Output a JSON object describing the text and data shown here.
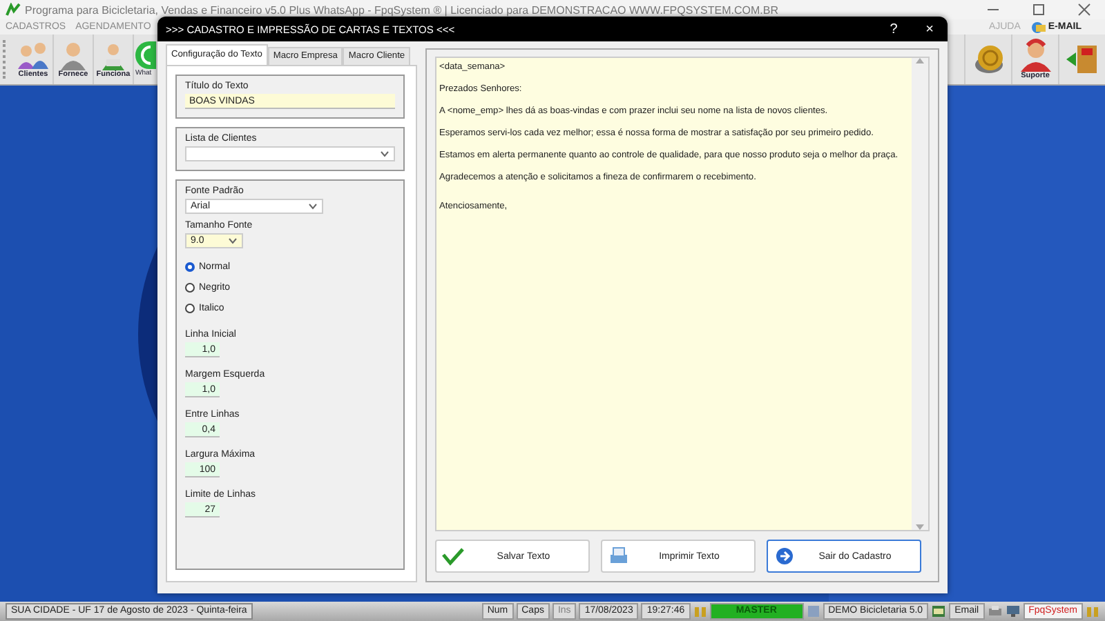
{
  "app": {
    "title": "Programa para Bicicletaria, Vendas e Financeiro v5.0 Plus WhatsApp - FpqSystem ® | Licenciado para  DEMONSTRACAO WWW.FPQSYSTEM.COM.BR",
    "menu": [
      {
        "label": "CADASTROS"
      },
      {
        "label": "AGENDAMENTO"
      }
    ],
    "menu_right": [
      {
        "kind": "text",
        "label": "AJUDA"
      },
      {
        "kind": "email",
        "label": "E-MAIL"
      }
    ],
    "toolbar_left": [
      {
        "kind": "people",
        "label": "Clientes"
      },
      {
        "kind": "person",
        "label": "Fornece"
      },
      {
        "kind": "worker",
        "label": "Funciona"
      },
      {
        "kind": "whatsapp",
        "label": "What"
      }
    ],
    "toolbar_right": [
      {
        "kind": "coins"
      },
      {
        "kind": "support",
        "label": "Suporte"
      },
      {
        "kind": "exit"
      }
    ]
  },
  "dialog": {
    "title": ">>>  CADASTRO E IMPRESSÃO DE CARTAS E TEXTOS  <<<",
    "help": "?",
    "close": "×",
    "tabs": [
      {
        "label": "Configuração do Texto",
        "selected": true
      },
      {
        "label": "Macro Empresa",
        "selected": false
      },
      {
        "label": "Macro Cliente",
        "selected": false
      }
    ],
    "title_field": {
      "label": "Título do Texto",
      "value": "BOAS VINDAS"
    },
    "client_list": {
      "label": "Lista de Clientes"
    },
    "font": {
      "label": "Fonte Padrão",
      "value": "Arial"
    },
    "font_size": {
      "label": "Tamanho Fonte",
      "value": "9.0"
    },
    "styles": [
      {
        "label": "Normal",
        "selected": true
      },
      {
        "label": "Negrito",
        "selected": false
      },
      {
        "label": "Italico",
        "selected": false
      }
    ],
    "numbers": [
      {
        "label": "Linha Inicial",
        "value": "1,0"
      },
      {
        "label": "Margem Esquerda",
        "value": "1,0"
      },
      {
        "label": "Entre Linhas",
        "value": "0,4"
      },
      {
        "label": "Largura Máxima",
        "value": "100"
      },
      {
        "label": "Limite de Linhas",
        "value": "27"
      }
    ],
    "editor": [
      "<data_semana>",
      "Prezados Senhores:",
      "A <nome_emp> lhes dá as boas-vindas e com prazer inclui seu nome na lista de novos clientes.",
      "Esperamos servi-los cada vez melhor; essa é nossa forma de mostrar a satisfação por seu primeiro pedido.",
      "Estamos em alerta permanente quanto ao controle de qualidade, para que nosso produto seja o melhor da praça.",
      "Agradecemos a atenção e solicitamos a fineza de confirmarem o recebimento.",
      "Atenciosamente,"
    ],
    "buttons": [
      {
        "kind": "check",
        "label": "Salvar Texto",
        "focused": false
      },
      {
        "kind": "print",
        "label": "Imprimir Texto",
        "focused": false
      },
      {
        "kind": "exit",
        "label": "Sair do Cadastro",
        "focused": true
      }
    ]
  },
  "status_bar": {
    "location": "SUA CIDADE - UF 17 de Agosto de 2023 - Quinta-feira",
    "cells": [
      {
        "kind": "text",
        "label": "Num",
        "disabled": false
      },
      {
        "kind": "text",
        "label": "Caps",
        "disabled": false
      },
      {
        "kind": "text",
        "label": "Ins",
        "disabled": true
      },
      {
        "kind": "text",
        "label": "17/08/2023",
        "disabled": false
      },
      {
        "kind": "text",
        "label": "19:27:46",
        "disabled": false
      },
      {
        "kind": "master",
        "label": "MASTER"
      },
      {
        "kind": "db",
        "label": "DEMO Bicicletaria 5.0"
      },
      {
        "kind": "email",
        "label": "Email"
      },
      {
        "kind": "icons"
      },
      {
        "kind": "brand",
        "label": "FpqSystem"
      }
    ]
  }
}
